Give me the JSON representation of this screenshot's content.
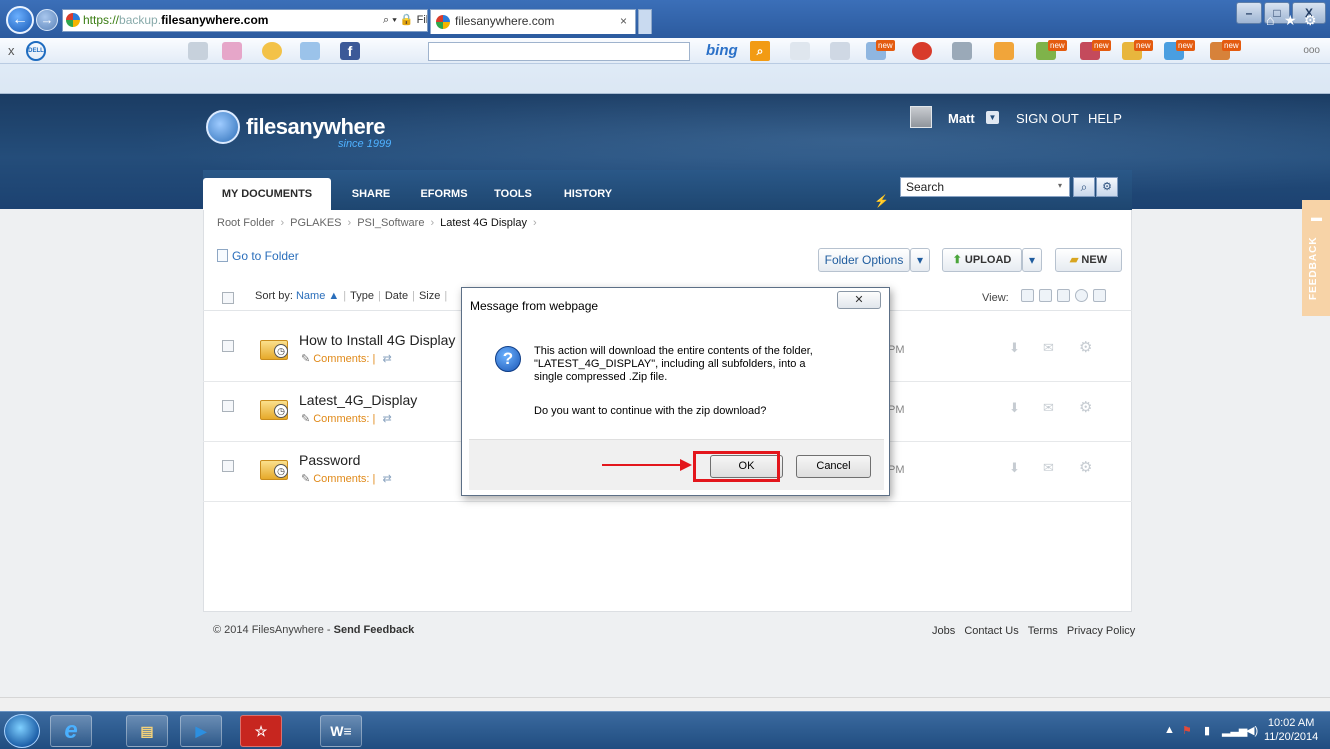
{
  "browser": {
    "url_scheme": "https://",
    "url_sub": "backup.",
    "url_host": "filesanywhere.com",
    "url_tail": "⌕ ▾ 🔒 FilesAn... ▤ C ×",
    "tab_title": "filesanywhere.com",
    "tab_close": "×",
    "back_glyph": "←",
    "fwd_glyph": "→",
    "bing_label": "bing",
    "bing_btn": "⌕",
    "toolbar_more": "ooo",
    "toolbar_close": "x",
    "dell_label": "DELL",
    "home_icon": "⌂",
    "star_icon": "★",
    "gear_icon": "⚙",
    "win_min": "–",
    "win_max": "□",
    "win_close": "X",
    "new_badge": "new"
  },
  "site": {
    "logo_text": "filesanywhere",
    "logo_since": "since 1999",
    "user_name": "Matt",
    "sign_out": "SIGN OUT",
    "help": "HELP",
    "tabs": [
      {
        "label": "MY DOCUMENTS",
        "active": true
      },
      {
        "label": "SHARE",
        "active": false
      },
      {
        "label": "EFORMS",
        "active": false
      },
      {
        "label": "TOOLS",
        "active": false
      },
      {
        "label": "HISTORY",
        "active": false
      }
    ],
    "search_placeholder": "Search"
  },
  "breadcrumb": [
    "Root Folder",
    "PGLAKES",
    "PSI_Software",
    "Latest 4G Display"
  ],
  "breadcrumb_sep": "›",
  "toolbar": {
    "goto_folder": "Go to Folder",
    "folder_options": "Folder Options",
    "upload": "UPLOAD",
    "new": "NEW",
    "dropdown": "▾"
  },
  "sortbar": {
    "sort_by": "Sort by:",
    "name": "Name ▲",
    "type": "Type",
    "date": "Date",
    "size": "Size",
    "view": "View:"
  },
  "files": [
    {
      "name": "How to Install 4G Display",
      "comments": "Comments:",
      "time": "PM"
    },
    {
      "name": "Latest_4G_Display",
      "comments": "Comments:",
      "time": "PM"
    },
    {
      "name": "Password",
      "comments": "Comments:",
      "time": "PM"
    }
  ],
  "footer": {
    "copyright": "© 2014 FilesAnywhere - ",
    "send_feedback": "Send Feedback",
    "links": [
      "Jobs",
      "Contact Us",
      "Terms",
      "Privacy Policy"
    ]
  },
  "feedback_tab": "FEEDBACK",
  "dialog": {
    "title": "Message from webpage",
    "close": "✕",
    "icon": "?",
    "message": "This action will download the entire contents of the folder, \"LATEST_4G_DISPLAY\", including all subfolders, into a single compressed .Zip file.",
    "question": "Do you want to continue with the zip download?",
    "ok": "OK",
    "cancel": "Cancel"
  },
  "taskbar": {
    "time": "10:02 AM",
    "date": "11/20/2014",
    "apps": [
      "e",
      "▤",
      "▶",
      "☆",
      "W≡"
    ]
  },
  "colors": {
    "accent_red": "#e3161c",
    "header_blue": "#244d7a",
    "link_blue": "#2a6ebb",
    "comments_orange": "#e08a1a"
  }
}
